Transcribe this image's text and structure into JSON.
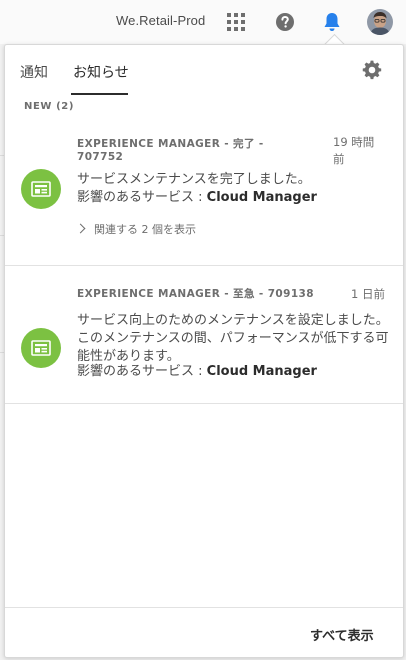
{
  "header": {
    "org_name": "We.Retail-Prod",
    "icons": [
      "app-grid-icon",
      "help-icon",
      "bell-icon"
    ],
    "accent_color": "#2680eb"
  },
  "panel": {
    "tabs": [
      {
        "label": "通知"
      },
      {
        "label": "お知らせ"
      }
    ],
    "section_label": "NEW (2)",
    "notifications": [
      {
        "title": "EXPERIENCE MANAGER - 完了 - 707752",
        "time": "19 時間前",
        "message": "サービスメンテナンスを完了しました。",
        "impact_prefix": "影響のあるサービス : ",
        "impact_service": "Cloud Manager",
        "related": "関連する 2 個を表示"
      },
      {
        "title": "EXPERIENCE MANAGER - 至急 - 709138",
        "time": "1 日前",
        "message": "サービス向上のためのメンテナンスを設定しました。このメンテナンスの間、パフォーマンスが低下する可能性があります。",
        "impact_prefix": "影響のあるサービス : ",
        "impact_service": "Cloud Manager"
      }
    ],
    "footer_label": "すべて表示",
    "icon_color": "#7cc142"
  }
}
